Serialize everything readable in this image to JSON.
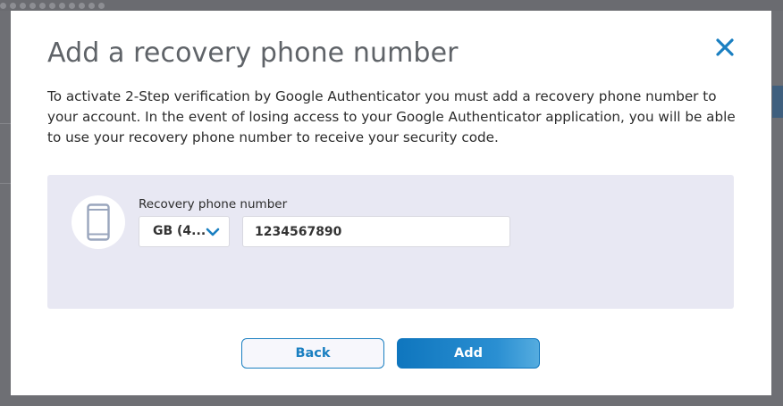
{
  "dialog": {
    "title": "Add a recovery phone number",
    "description": "To activate 2-Step verification by Google Authenticator you must add a recovery phone number to your account. In the event of losing access to your Google Authenticator application, you will be able to use your recovery phone number to receive your security code.",
    "close_icon": "close-icon"
  },
  "form": {
    "phone_icon": "mobile-phone-icon",
    "label": "Recovery phone number",
    "country_value": "GB (4...",
    "country_chevron_icon": "chevron-down-icon",
    "phone_value": "1234567890"
  },
  "buttons": {
    "back_label": "Back",
    "add_label": "Add"
  },
  "colors": {
    "accent": "#1a7fc1",
    "form_background": "#e8e8f3",
    "overlay": "#5a5b60"
  }
}
